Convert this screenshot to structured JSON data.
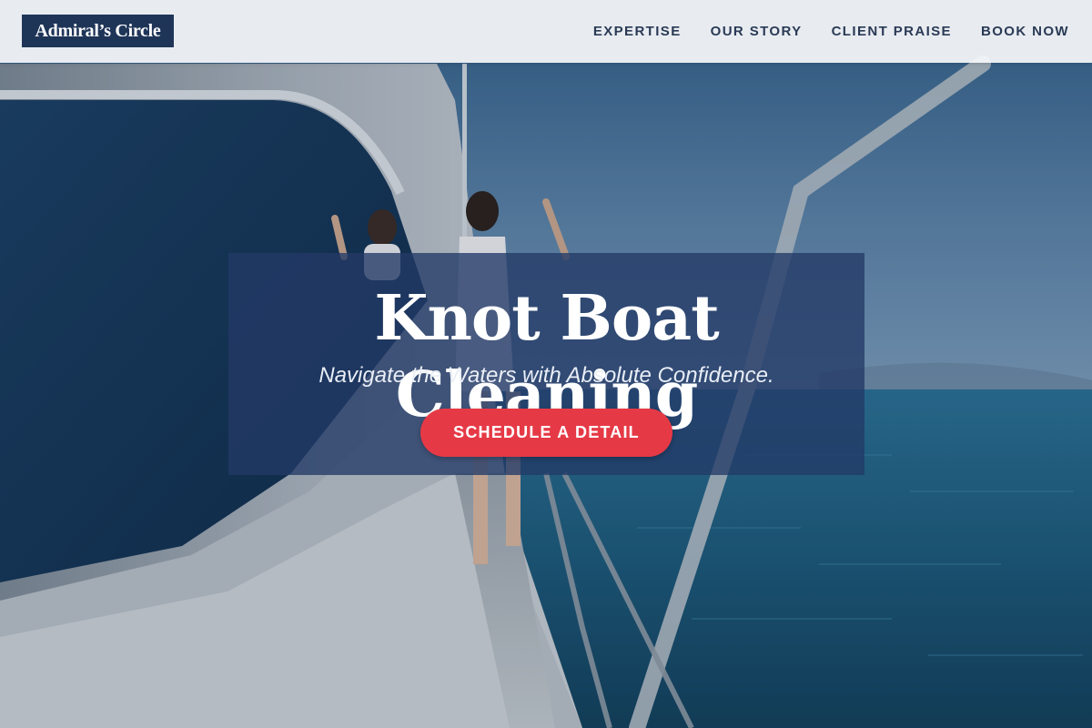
{
  "header": {
    "logo_text": "Admiral’s Circle",
    "nav": [
      {
        "label": "EXPERTISE"
      },
      {
        "label": "OUR STORY"
      },
      {
        "label": "CLIENT PRAISE"
      },
      {
        "label": "BOOK NOW"
      }
    ]
  },
  "hero": {
    "title": "Knot Boat Cleaning",
    "tagline": "Navigate the Waters with Absolute Confidence.",
    "cta_label": "SCHEDULE A DETAIL"
  },
  "colors": {
    "brand_navy": "#1f3558",
    "accent_red": "#e63946",
    "nav_text": "#2a3a55"
  }
}
